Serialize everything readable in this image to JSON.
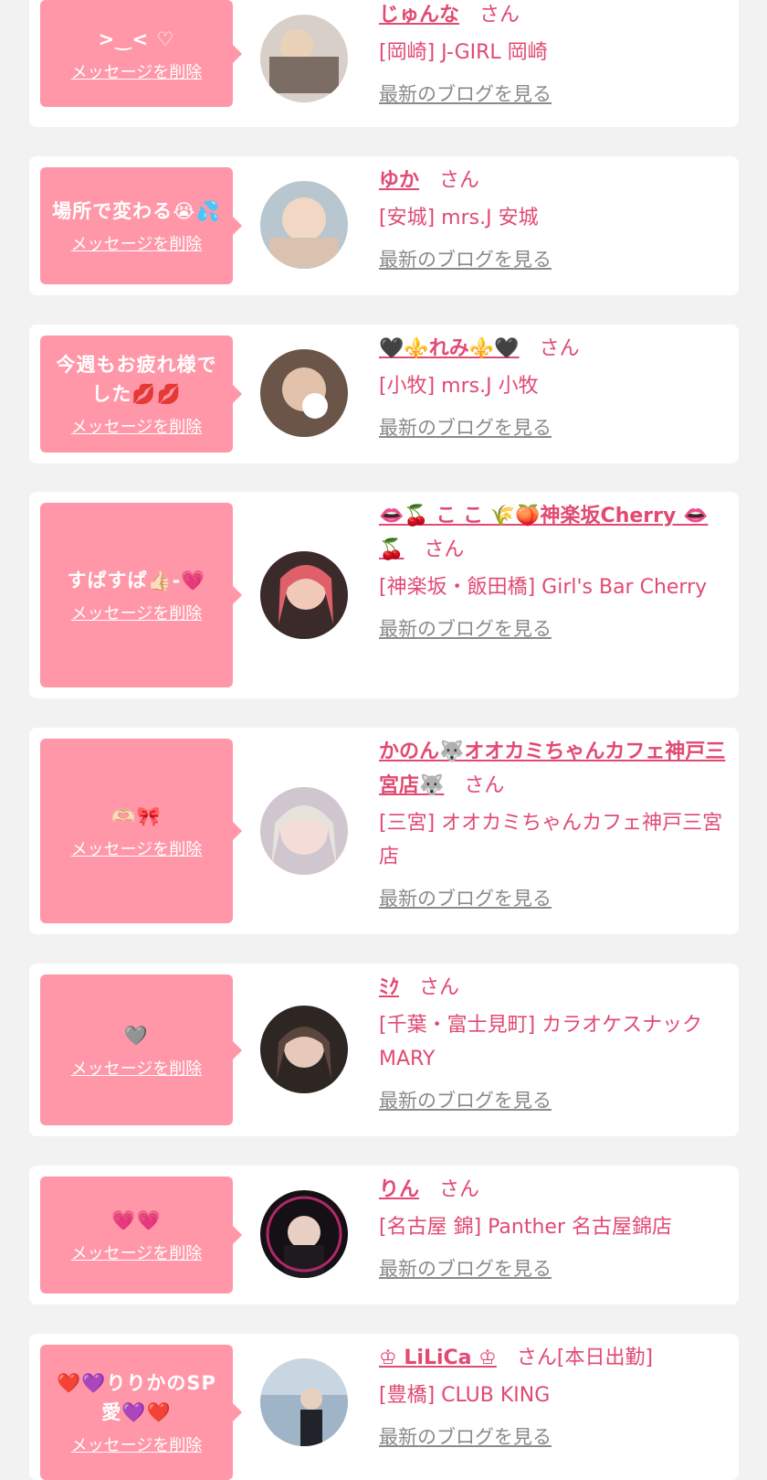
{
  "delete_label": "メッセージを削除",
  "blog_label": "最新のブログを見る",
  "san_label": "さん",
  "colors": {
    "background": "#f2f2f2",
    "bubble": "#ff97a8",
    "accent": "#e14a72",
    "link_gray": "#8a8a8a"
  },
  "items": [
    {
      "message": ">‿< ♡",
      "name": "じゅんな",
      "extra": "",
      "shop": "[岡崎] J-GIRL 岡崎"
    },
    {
      "message": "場所で変わる😭💦",
      "name": "ゆか",
      "extra": "",
      "shop": "[安城] mrs.J 安城"
    },
    {
      "message": "今週もお疲れ様でした💋💋",
      "name": "🖤⚜️れみ⚜️🖤",
      "extra": "",
      "shop": "[小牧] mrs.J 小牧"
    },
    {
      "message": "すぱすぱ👍🏻-💗",
      "name": "👄🍒 こ こ 🌾🍑神楽坂Cherry 👄🍒",
      "extra": "",
      "shop": "[神楽坂・飯田橋] Girl's Bar Cherry"
    },
    {
      "message": "🫶🏻🎀",
      "name": "かのん🐺オオカミちゃんカフェ神戸三宮店🐺",
      "extra": "",
      "shop": "[三宮] オオカミちゃんカフェ神戸三宮店"
    },
    {
      "message": "🩶",
      "name": "ﾐｸ",
      "extra": "",
      "shop": "[千葉・富士見町] カラオケスナック MARY"
    },
    {
      "message": "💗💗",
      "name": "りん",
      "extra": "",
      "shop": "[名古屋 錦] Panther 名古屋錦店"
    },
    {
      "message": "❤️💜りりかのSP愛💜❤️",
      "name": "♔ LiLiCa ♔",
      "extra": "[本日出勤]",
      "shop": "[豊橋] CLUB KING"
    }
  ]
}
